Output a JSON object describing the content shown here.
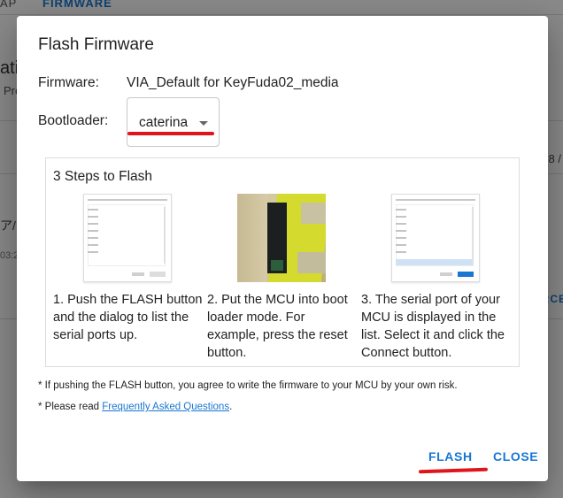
{
  "background": {
    "tab1": "AP",
    "tab2": "FIRMWARE",
    "heading": "ati",
    "subheading": "Pre",
    "right_text": "8 /",
    "jp_text": "ア/",
    "time_text": "03:2",
    "action": "RCE"
  },
  "dialog": {
    "title": "Flash Firmware",
    "firmware_label": "Firmware:",
    "firmware_value": "VIA_Default for KeyFuda02_media",
    "bootloader_label": "Bootloader:",
    "bootloader_value": "caterina",
    "steps_title": "3 Steps to Flash",
    "steps": [
      {
        "text": "1. Push the FLASH button and the dialog to list the serial ports up."
      },
      {
        "text": "2. Put the MCU into boot loader mode. For example, press the reset button."
      },
      {
        "text": "3. The serial port of your MCU is displayed in the list. Select it and click the Connect button."
      }
    ],
    "note1": "* If pushing the FLASH button, you agree to write the firmware to your MCU by your own risk.",
    "note2_prefix": "* Please read ",
    "note2_link": "Frequently Asked Questions",
    "note2_suffix": ".",
    "flash_button": "FLASH",
    "close_button": "CLOSE"
  },
  "colors": {
    "accent": "#1976d2",
    "highlight": "#e0151b"
  }
}
